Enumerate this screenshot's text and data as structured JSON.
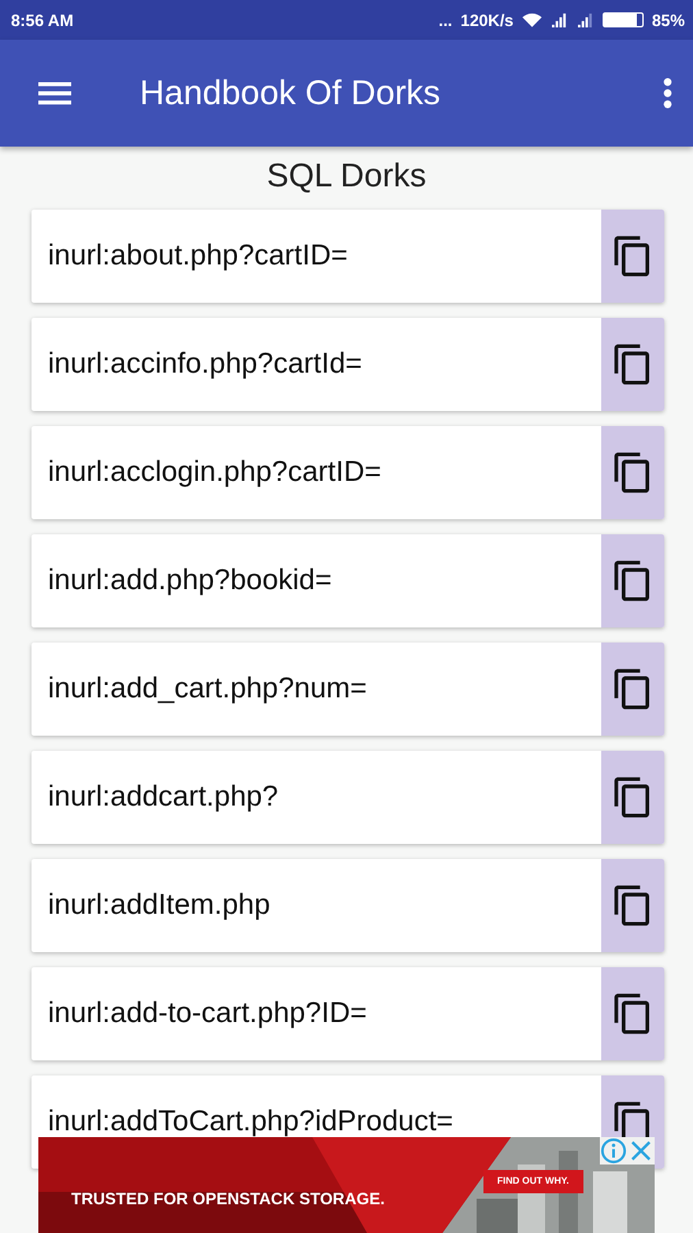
{
  "status_bar": {
    "time": "8:56 AM",
    "more": "...",
    "speed": "120K/s",
    "battery": "85%"
  },
  "app_bar": {
    "title": "Handbook Of Dorks"
  },
  "section_title": "SQL Dorks",
  "dorks": [
    {
      "text": "inurl:about.php?cartID="
    },
    {
      "text": "inurl:accinfo.php?cartId="
    },
    {
      "text": "inurl:acclogin.php?cartID="
    },
    {
      "text": "inurl:add.php?bookid="
    },
    {
      "text": "inurl:add_cart.php?num="
    },
    {
      "text": "inurl:addcart.php?"
    },
    {
      "text": "inurl:addItem.php"
    },
    {
      "text": "inurl:add-to-cart.php?ID="
    },
    {
      "text": "inurl:addToCart.php?idProduct="
    }
  ],
  "ad": {
    "headline": "TRUSTED FOR OPENSTACK STORAGE.",
    "cta": "FIND OUT WHY."
  }
}
